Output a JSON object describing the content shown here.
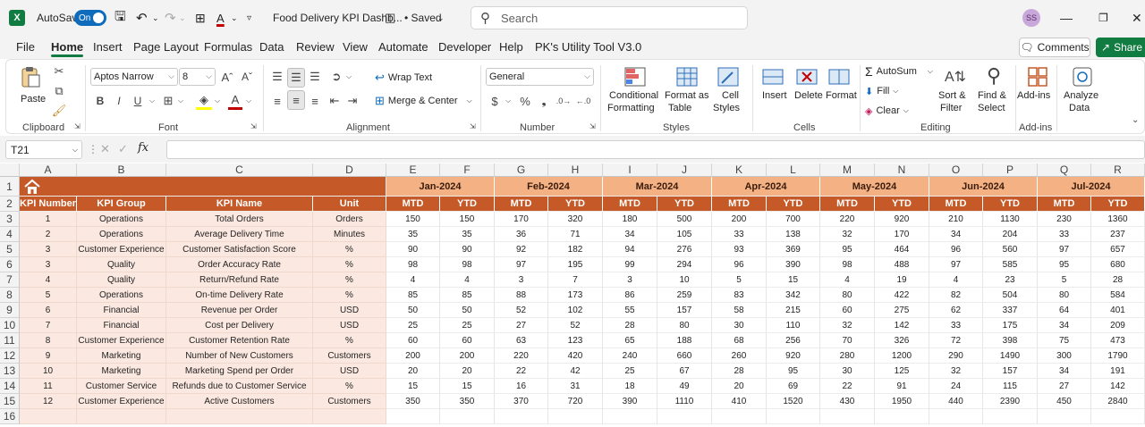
{
  "titlebar": {
    "autosave_label": "AutoSave",
    "autosave_state": "On",
    "doc_title": "Food Delivery KPI Dashb...",
    "saved_label": "• Saved",
    "search_placeholder": "Search",
    "user_initials": "SS"
  },
  "menu": {
    "items": [
      "File",
      "Home",
      "Insert",
      "Page Layout",
      "Formulas",
      "Data",
      "Review",
      "View",
      "Automate",
      "Developer",
      "Help",
      "PK's Utility Tool V3.0"
    ],
    "active": "Home",
    "comments_label": "Comments",
    "share_label": "Share"
  },
  "ribbon": {
    "clipboard": {
      "paste": "Paste",
      "label": "Clipboard"
    },
    "font": {
      "name": "Aptos Narrow",
      "size": "8",
      "label": "Font",
      "bold": "B",
      "italic": "I",
      "underline": "U"
    },
    "alignment": {
      "wrap": "Wrap Text",
      "merge": "Merge & Center",
      "label": "Alignment"
    },
    "number": {
      "format": "General",
      "label": "Number"
    },
    "styles": {
      "conditional_1": "Conditional",
      "conditional_2": "Formatting",
      "format_table_1": "Format as",
      "format_table_2": "Table",
      "cell_styles_1": "Cell",
      "cell_styles_2": "Styles",
      "label": "Styles"
    },
    "cells": {
      "insert": "Insert",
      "delete": "Delete",
      "format": "Format",
      "label": "Cells"
    },
    "editing": {
      "autosum": "AutoSum",
      "fill": "Fill",
      "clear": "Clear",
      "sort_1": "Sort &",
      "sort_2": "Filter",
      "find_1": "Find &",
      "find_2": "Select",
      "label": "Editing"
    },
    "addins": {
      "addins": "Add-ins",
      "label": "Add-ins"
    },
    "analyze": {
      "line1": "Analyze",
      "line2": "Data"
    }
  },
  "formula_bar": {
    "name_box": "T21",
    "fx": "fx",
    "value": ""
  },
  "sheet": {
    "columns": [
      "A",
      "B",
      "C",
      "D",
      "E",
      "F",
      "G",
      "H",
      "I",
      "J",
      "K",
      "L",
      "M",
      "N",
      "O",
      "P",
      "Q",
      "R"
    ],
    "rows": [
      "1",
      "2",
      "3",
      "4",
      "5",
      "6",
      "7",
      "8",
      "9",
      "10",
      "11",
      "12",
      "13",
      "14",
      "15",
      "16"
    ],
    "months": [
      "Jan-2024",
      "Feb-2024",
      "Mar-2024",
      "Apr-2024",
      "May-2024",
      "Jun-2024",
      "Jul-2024"
    ],
    "headers": [
      "KPI Number",
      "KPI Group",
      "KPI Name",
      "Unit"
    ],
    "mtd": "MTD",
    "ytd": "YTD",
    "data": [
      [
        "1",
        "Operations",
        "Total Orders",
        "Orders",
        "150",
        "150",
        "170",
        "320",
        "180",
        "500",
        "200",
        "700",
        "220",
        "920",
        "210",
        "1130",
        "230",
        "1360"
      ],
      [
        "2",
        "Operations",
        "Average Delivery Time",
        "Minutes",
        "35",
        "35",
        "36",
        "71",
        "34",
        "105",
        "33",
        "138",
        "32",
        "170",
        "34",
        "204",
        "33",
        "237"
      ],
      [
        "3",
        "Customer Experience",
        "Customer Satisfaction Score",
        "%",
        "90",
        "90",
        "92",
        "182",
        "94",
        "276",
        "93",
        "369",
        "95",
        "464",
        "96",
        "560",
        "97",
        "657"
      ],
      [
        "3",
        "Quality",
        "Order Accuracy Rate",
        "%",
        "98",
        "98",
        "97",
        "195",
        "99",
        "294",
        "96",
        "390",
        "98",
        "488",
        "97",
        "585",
        "95",
        "680"
      ],
      [
        "4",
        "Quality",
        "Return/Refund Rate",
        "%",
        "4",
        "4",
        "3",
        "7",
        "3",
        "10",
        "5",
        "15",
        "4",
        "19",
        "4",
        "23",
        "5",
        "28"
      ],
      [
        "5",
        "Operations",
        "On-time Delivery Rate",
        "%",
        "85",
        "85",
        "88",
        "173",
        "86",
        "259",
        "83",
        "342",
        "80",
        "422",
        "82",
        "504",
        "80",
        "584"
      ],
      [
        "6",
        "Financial",
        "Revenue per Order",
        "USD",
        "50",
        "50",
        "52",
        "102",
        "55",
        "157",
        "58",
        "215",
        "60",
        "275",
        "62",
        "337",
        "64",
        "401"
      ],
      [
        "7",
        "Financial",
        "Cost per Delivery",
        "USD",
        "25",
        "25",
        "27",
        "52",
        "28",
        "80",
        "30",
        "110",
        "32",
        "142",
        "33",
        "175",
        "34",
        "209"
      ],
      [
        "8",
        "Customer Experience",
        "Customer Retention Rate",
        "%",
        "60",
        "60",
        "63",
        "123",
        "65",
        "188",
        "68",
        "256",
        "70",
        "326",
        "72",
        "398",
        "75",
        "473"
      ],
      [
        "9",
        "Marketing",
        "Number of New Customers",
        "Customers",
        "200",
        "200",
        "220",
        "420",
        "240",
        "660",
        "260",
        "920",
        "280",
        "1200",
        "290",
        "1490",
        "300",
        "1790"
      ],
      [
        "10",
        "Marketing",
        "Marketing Spend per Order",
        "USD",
        "20",
        "20",
        "22",
        "42",
        "25",
        "67",
        "28",
        "95",
        "30",
        "125",
        "32",
        "157",
        "34",
        "191"
      ],
      [
        "11",
        "Customer Service",
        "Refunds due to Customer Service",
        "%",
        "15",
        "15",
        "16",
        "31",
        "18",
        "49",
        "20",
        "69",
        "22",
        "91",
        "24",
        "115",
        "27",
        "142"
      ],
      [
        "12",
        "Customer Experience",
        "Active Customers",
        "Customers",
        "350",
        "350",
        "370",
        "720",
        "390",
        "1110",
        "410",
        "1520",
        "430",
        "1950",
        "440",
        "2390",
        "450",
        "2840"
      ]
    ]
  }
}
